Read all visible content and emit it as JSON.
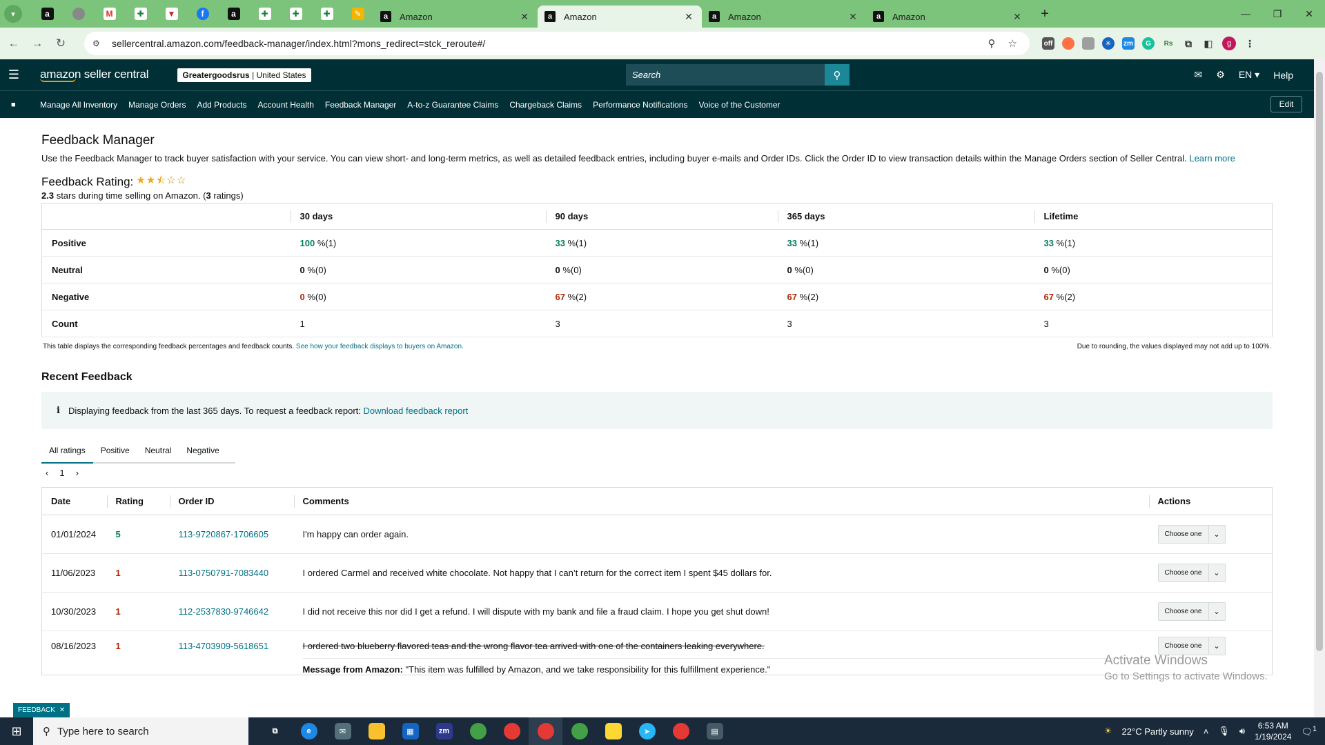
{
  "browser": {
    "tabs": [
      {
        "title": "Amazon",
        "active": false
      },
      {
        "title": "Amazon",
        "active": true
      },
      {
        "title": "Amazon",
        "active": false
      },
      {
        "title": "Amazon",
        "active": false
      }
    ],
    "url": "sellercentral.amazon.com/feedback-manager/index.html?mons_redirect=stck_reroute#/",
    "profile_initial": "g",
    "colors": {
      "tabbar": "#7cc47c",
      "toolbar": "#e9f4e9"
    }
  },
  "header": {
    "logo_text": "amazon seller central",
    "store_name": "Greatergoodsrus",
    "store_region": " | United States",
    "search_placeholder": "Search",
    "language": "EN",
    "help": "Help",
    "colors": {
      "bg": "#002f36",
      "search_btn": "#1b8797"
    }
  },
  "nav": {
    "links": [
      "Manage All Inventory",
      "Manage Orders",
      "Add Products",
      "Account Health",
      "Feedback Manager",
      "A-to-z Guarantee Claims",
      "Chargeback Claims",
      "Performance Notifications",
      "Voice of the Customer"
    ],
    "edit": "Edit"
  },
  "page": {
    "title": "Feedback Manager",
    "description": "Use the Feedback Manager to track buyer satisfaction with your service. You can view short- and long-term metrics, as well as detailed feedback entries, including buyer e-mails and Order IDs. Click the Order ID to view transaction details within the Manage Orders section of Seller Central.",
    "learn_more": "Learn more",
    "rating_title": "Feedback Rating:",
    "rating_value": 2.3,
    "rating_stars": "2.3",
    "rating_sub_middle": " stars during time selling on Amazon. (",
    "rating_count": "3",
    "rating_sub_end": " ratings)"
  },
  "metrics": {
    "columns": [
      "30 days",
      "90 days",
      "365 days",
      "Lifetime"
    ],
    "rows": [
      {
        "label": "Positive",
        "type": "pos",
        "cells": [
          {
            "pct": "100",
            "n": " %(1)"
          },
          {
            "pct": "33",
            "n": " %(1)"
          },
          {
            "pct": "33",
            "n": " %(1)"
          },
          {
            "pct": "33",
            "n": " %(1)"
          }
        ]
      },
      {
        "label": "Neutral",
        "type": "neu",
        "cells": [
          {
            "pct": "0",
            "n": " %(0)"
          },
          {
            "pct": "0",
            "n": " %(0)"
          },
          {
            "pct": "0",
            "n": " %(0)"
          },
          {
            "pct": "0",
            "n": " %(0)"
          }
        ]
      },
      {
        "label": "Negative",
        "type": "neg",
        "cells": [
          {
            "pct": "0",
            "n": " %(0)"
          },
          {
            "pct": "67",
            "n": " %(2)"
          },
          {
            "pct": "67",
            "n": " %(2)"
          },
          {
            "pct": "67",
            "n": " %(2)"
          }
        ]
      },
      {
        "label": "Count",
        "type": "count",
        "cells": [
          {
            "pct": "1",
            "n": ""
          },
          {
            "pct": "3",
            "n": ""
          },
          {
            "pct": "3",
            "n": ""
          },
          {
            "pct": "3",
            "n": ""
          }
        ]
      }
    ],
    "note_left": "This table displays the corresponding feedback percentages and feedback counts.",
    "note_link": "See how your feedback displays to buyers on Amazon.",
    "note_right": "Due to rounding, the values displayed may not add up to 100%."
  },
  "recent": {
    "title": "Recent Feedback",
    "banner_text": "Displaying feedback from the last 365 days. To request a feedback report:",
    "banner_link": "Download feedback report",
    "tabs": [
      "All ratings",
      "Positive",
      "Neutral",
      "Negative"
    ],
    "page": "1",
    "columns": [
      "Date",
      "Rating",
      "Order ID",
      "Comments",
      "Actions"
    ],
    "choose_label": "Choose one",
    "rows": [
      {
        "date": "01/01/2024",
        "rating": "5",
        "order": "113-9720867-1706605",
        "comment": "I'm happy can order again.",
        "positive": true
      },
      {
        "date": "11/06/2023",
        "rating": "1",
        "order": "113-0750791-7083440",
        "comment": "I ordered Carmel and received white chocolate. Not happy that I can’t return for the correct item I spent $45 dollars for.",
        "positive": false
      },
      {
        "date": "10/30/2023",
        "rating": "1",
        "order": "112-2537830-9746642",
        "comment": "I did not receive this nor did I get a refund. I will dispute with my bank and file a fraud claim. I hope you get shut down!",
        "positive": false
      },
      {
        "date": "08/16/2023",
        "rating": "1",
        "order": "113-4703909-5618651",
        "comment": "I ordered two blueberry flavored teas and the wrong flavor tea arrived with one of the containers leaking everywhere.",
        "positive": false,
        "struck": true
      }
    ],
    "amazon_message_label": "Message from Amazon:",
    "amazon_message": " \"This item was fulfilled by Amazon, and we take responsibility for this fulfillment experience.\""
  },
  "watermark": {
    "line1": "Activate Windows",
    "line2": "Go to Settings to activate Windows."
  },
  "feedback_tag": "FEEDBACK",
  "taskbar": {
    "search_placeholder": "Type here to search",
    "weather": "22°C  Partly sunny",
    "time": "6:53 AM",
    "date": "1/19/2024",
    "notif_count": "1"
  }
}
